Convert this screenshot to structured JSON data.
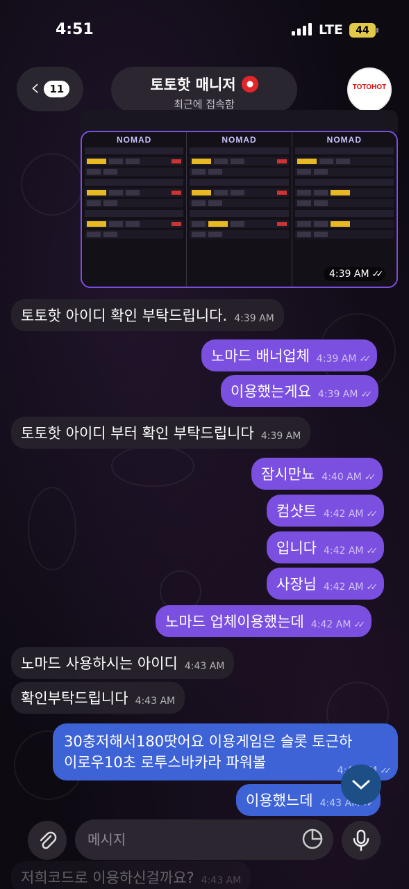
{
  "status_bar": {
    "time": "4:51",
    "network": "LTE",
    "battery": "44"
  },
  "header": {
    "back_count": "11",
    "title": "토토핫 매니저",
    "subtitle": "최근에 접속함",
    "avatar_logo": "TOTOHOT"
  },
  "media_message": {
    "logo": "NOMAD",
    "time": "4:39 AM"
  },
  "messages": [
    {
      "dir": "in",
      "text": "토토핫 아이디 확인 부탁드립니다.",
      "time": "4:39 AM"
    },
    {
      "dir": "out",
      "text": "노마드 배너업체",
      "time": "4:39 AM"
    },
    {
      "dir": "out",
      "text": "이용했는게요",
      "time": "4:39 AM"
    },
    {
      "dir": "in",
      "text": "토토핫 아이디 부터 확인 부탁드립니다",
      "time": "4:39 AM"
    },
    {
      "dir": "out",
      "text": "잠시만뇨",
      "time": "4:40 AM"
    },
    {
      "dir": "out",
      "text": "컴샷트",
      "time": "4:42 AM"
    },
    {
      "dir": "out",
      "text": "입니다",
      "time": "4:42 AM"
    },
    {
      "dir": "out",
      "text": "사장님",
      "time": "4:42 AM"
    },
    {
      "dir": "out",
      "text": "노마드 업체이용했는데",
      "time": "4:42 AM"
    },
    {
      "dir": "in",
      "text": "노마드 사용하시는 아이디",
      "time": "4:43 AM"
    },
    {
      "dir": "in",
      "text": "확인부탁드립니다",
      "time": "4:43 AM"
    },
    {
      "dir": "out",
      "text_line1": "30충저해서180땃어요 이용게임은 슬롯 토근하",
      "text_line2": "이로우10초 로투스바카라 파워볼",
      "time": "4:43 AM"
    },
    {
      "dir": "out",
      "text": "이용했느데",
      "time": "4:43 AM"
    },
    {
      "dir": "in",
      "text": "저희코드로 이용하신걸까요?",
      "time": "4:43 AM"
    }
  ],
  "composer": {
    "placeholder": "메시지"
  },
  "icons": {
    "back": "chevron-left-icon",
    "attach": "paperclip-icon",
    "sticker": "sticker-icon",
    "mic": "microphone-icon",
    "scroll": "chevron-down-icon"
  },
  "colors": {
    "outgoing": "#7b4fe0",
    "incoming": "#26222a",
    "scroll_button": "#1d4f86"
  }
}
